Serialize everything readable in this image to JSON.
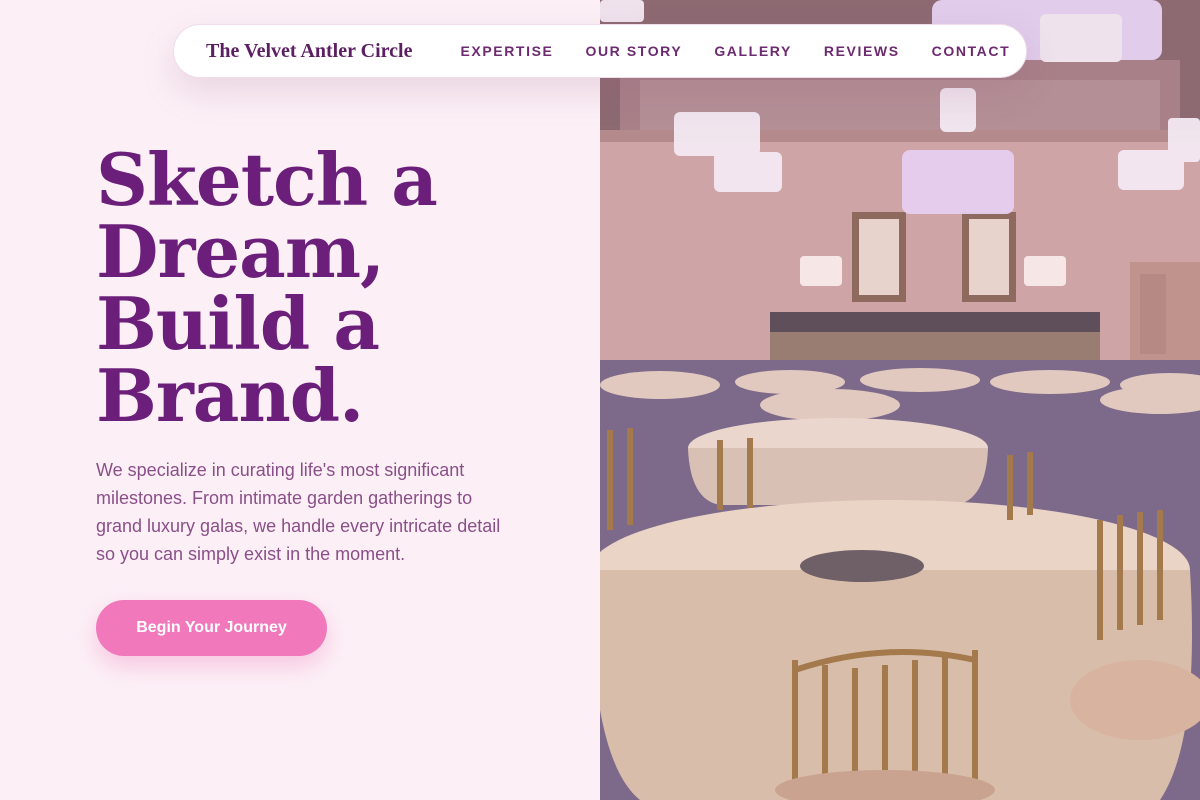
{
  "nav": {
    "brand": "The Velvet Antler Circle",
    "links": [
      "EXPERTISE",
      "OUR STORY",
      "GALLERY",
      "REVIEWS",
      "CONTACT"
    ]
  },
  "hero": {
    "headline_lines": [
      "Sketch a",
      "Dream,",
      "Build a",
      "Brand."
    ],
    "subtext": "We specialize in curating life's most significant milestones. From intimate garden gatherings to grand luxury galas, we handle every intricate detail so you can simply exist in the moment.",
    "cta_label": "Begin Your Journey"
  },
  "image": {
    "subject": "ballroom-with-round-tables-and-chandeliers"
  },
  "colors": {
    "background": "#fcf0f6",
    "headline": "#6b1f7a",
    "body_text": "#8a4f88",
    "accent": "#f078bb",
    "brand": "#5c1f63"
  }
}
